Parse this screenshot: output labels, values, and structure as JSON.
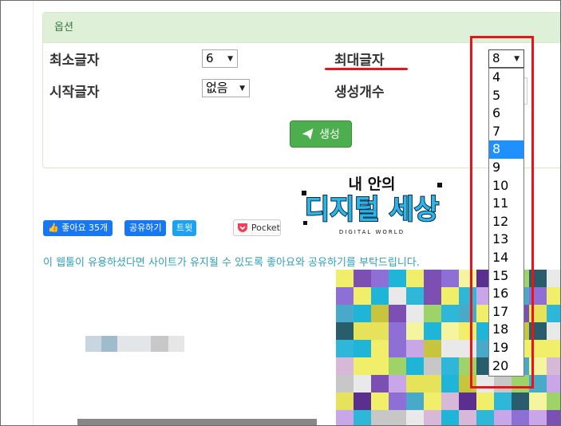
{
  "panel": {
    "header": "옵션",
    "labels": {
      "min_chars": "최소글자",
      "max_chars": "최대글자",
      "start_char": "시작글자",
      "count": "생성개수"
    },
    "min_select": "6",
    "max_select": "8",
    "start_select": "없음",
    "generate_button": "생성"
  },
  "dropdown": {
    "options": [
      "4",
      "5",
      "6",
      "7",
      "8",
      "9",
      "10",
      "11",
      "12",
      "13",
      "14",
      "15",
      "16",
      "17",
      "18",
      "19",
      "20"
    ],
    "selected": "8"
  },
  "logo": {
    "line1": "내 안의",
    "line2": "디지털 세상",
    "line3": "DIGITAL WORLD"
  },
  "share": {
    "like": "좋아요 35개",
    "share": "공유하기",
    "tweet": "트윗",
    "pocket": "Pocket"
  },
  "notice": "이 웹툴이 유용하셨다면 사이트가 유지될 수 있도록 좋아요와 공유하기를 부탁드립니다.",
  "colors": {
    "accent_red": "#e8141a",
    "button_green": "#4cae4c",
    "header_bg": "#dff0d8",
    "selected_blue": "#1e90ff"
  }
}
